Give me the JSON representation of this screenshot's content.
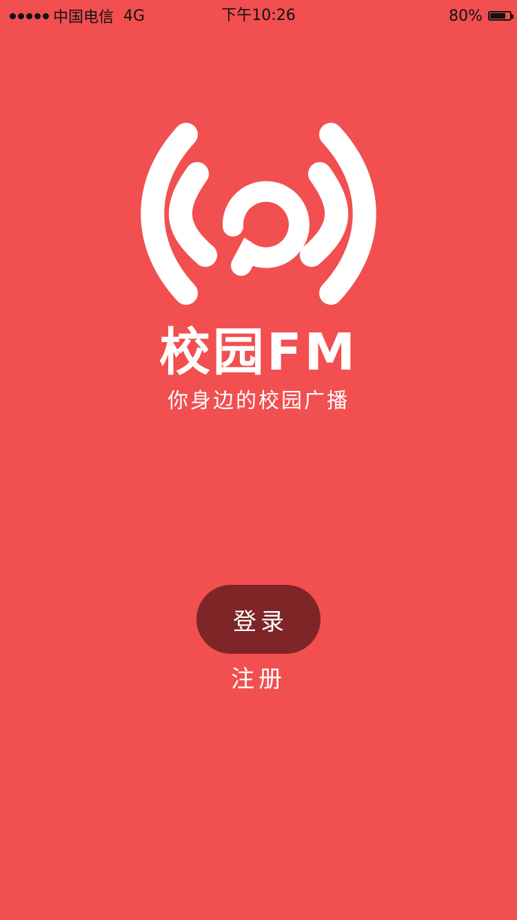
{
  "status_bar": {
    "carrier": "中国电信",
    "network": "4G",
    "time": "下午10:26",
    "battery_percent": "80%",
    "battery_level": 0.8
  },
  "brand": {
    "logo_icon": "radio-broadcast-icon",
    "title": "校园FM",
    "subtitle": "你身边的校园广播"
  },
  "actions": {
    "login_label": "登录",
    "register_label": "注册"
  },
  "colors": {
    "background": "#F14F50",
    "login_button": "#7E2527",
    "foreground": "#FFFFFF"
  }
}
